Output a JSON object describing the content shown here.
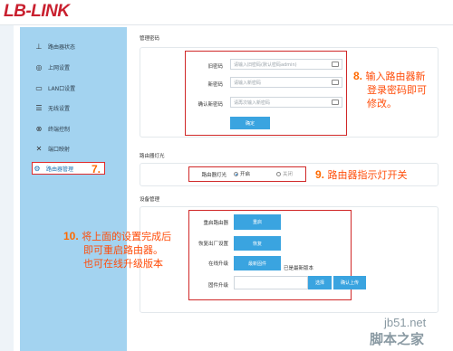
{
  "header": {
    "logo": "LB-LINK"
  },
  "sidebar": {
    "items": [
      {
        "label": "路由器状态",
        "icon": "router-status-icon",
        "glyph": "⊥"
      },
      {
        "label": "上网设置",
        "icon": "globe-icon",
        "glyph": "◎"
      },
      {
        "label": "LAN口设置",
        "icon": "lan-port-icon",
        "glyph": "▭"
      },
      {
        "label": "无线设置",
        "icon": "wifi-icon",
        "glyph": "☰"
      },
      {
        "label": "终端控制",
        "icon": "terminal-control-icon",
        "glyph": "⊗"
      },
      {
        "label": "端口映射",
        "icon": "port-mapping-icon",
        "glyph": "✕"
      },
      {
        "label": "路由器管理",
        "icon": "gear-icon",
        "glyph": "⚙"
      }
    ]
  },
  "password": {
    "section_title": "管理密码",
    "old_label": "旧密码",
    "old_placeholder": "请输入旧密码(默认密码admin)",
    "new_label": "新密码",
    "new_placeholder": "请输入新密码",
    "confirm_label": "确认新密码",
    "confirm_placeholder": "请再次输入新密码",
    "submit_label": "确定"
  },
  "light": {
    "section_title": "路由器灯光",
    "label": "路由器灯光",
    "on_label": "开启",
    "off_label": "关闭",
    "selected": "开启"
  },
  "device": {
    "section_title": "设备管理",
    "reboot_label": "重启路由器",
    "reboot_btn": "重启",
    "reset_label": "恢复出厂设置",
    "reset_btn": "恢复",
    "online_label": "在线升级",
    "online_btn": "最新固件",
    "online_status": "已是最新版本",
    "firmware_label": "固件升级",
    "choose_btn": "选择",
    "upload_btn": "确认上传"
  },
  "annotations": {
    "a7_num": "7.",
    "a8_num": "8.",
    "a8_line1": "输入路由器新",
    "a8_line2": "登录密码即可",
    "a8_line3": "修改。",
    "a9_num": "9.",
    "a9_text": "路由器指示灯开关",
    "a10_num": "10.",
    "a10_line1": "将上面的设置完成后",
    "a10_line2": "即可重启路由器。",
    "a10_line3": "也可在线升级版本"
  },
  "watermark": {
    "site": "jb51.net",
    "name": "脚本之家"
  },
  "colors": {
    "brand": "#c9202f",
    "sidebar": "#a3d3f0",
    "button": "#3aa4e0",
    "annotation": "#ff4d0a",
    "highlight": "#d02828"
  }
}
